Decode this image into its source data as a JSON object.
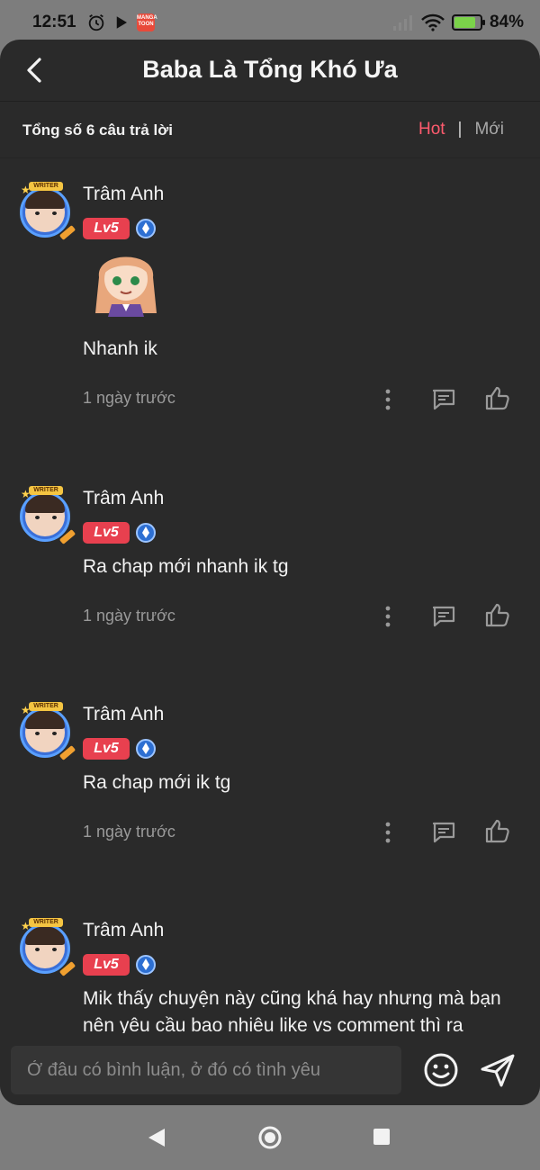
{
  "status": {
    "time": "12:51",
    "manga_icon_text": "MANGA TOON",
    "battery": "84%",
    "battery_level": 0.84
  },
  "header": {
    "title": "Baba Là Tổng Khó Ưa"
  },
  "subbar": {
    "total": "Tổng số 6 câu trả lời",
    "sort_hot": "Hot",
    "sort_separator": "|",
    "sort_new": "Mới"
  },
  "badge_writer": "WRITER",
  "comments": [
    {
      "user": "Trâm Anh",
      "level": "Lv5",
      "text": "Nhanh ik",
      "date": "1 ngày trước",
      "has_sticker": true
    },
    {
      "user": "Trâm Anh",
      "level": "Lv5",
      "text": "Ra chap mới nhanh ik tg",
      "date": "1 ngày trước",
      "has_sticker": false
    },
    {
      "user": "Trâm Anh",
      "level": "Lv5",
      "text": "Ra chap mới ik tg",
      "date": "1 ngày trước",
      "has_sticker": false
    },
    {
      "user": "Trâm Anh",
      "level": "Lv5",
      "text_line1": "Mik thấy chuyện này cũng khá hay nhưng mà bạn",
      "text_line2": "nên yêu cầu bao nhiêu like vs comment thì ra",
      "has_sticker": false
    }
  ],
  "input": {
    "placeholder": "Ở đâu có bình luận, ở đó có tình yêu"
  },
  "colors": {
    "accent": "#ff5b6e",
    "level_badge": "#e8404f",
    "panel_bg": "#2a2a2a"
  },
  "icons": [
    "back-arrow-icon",
    "more-vertical-icon",
    "reply-comment-icon",
    "thumbs-up-icon",
    "emoji-icon",
    "send-icon",
    "verified-icon"
  ]
}
